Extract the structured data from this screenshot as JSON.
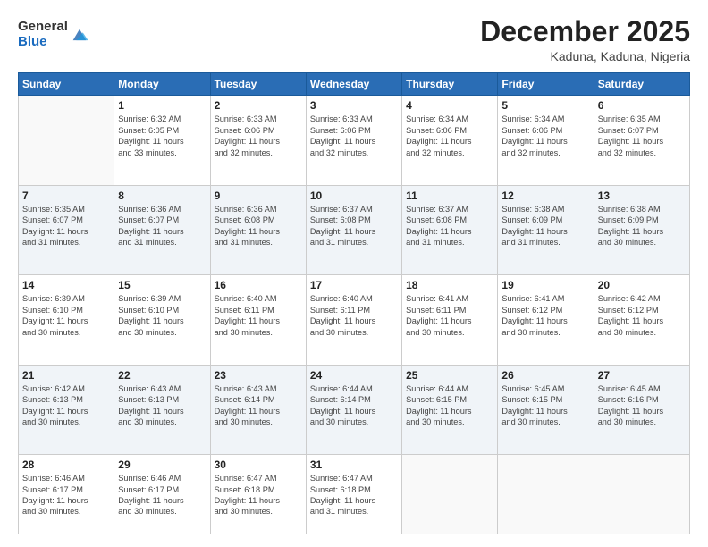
{
  "logo": {
    "general": "General",
    "blue": "Blue"
  },
  "header": {
    "month": "December 2025",
    "location": "Kaduna, Kaduna, Nigeria"
  },
  "days_of_week": [
    "Sunday",
    "Monday",
    "Tuesday",
    "Wednesday",
    "Thursday",
    "Friday",
    "Saturday"
  ],
  "weeks": [
    [
      {
        "day": "",
        "info": ""
      },
      {
        "day": "1",
        "info": "Sunrise: 6:32 AM\nSunset: 6:05 PM\nDaylight: 11 hours\nand 33 minutes."
      },
      {
        "day": "2",
        "info": "Sunrise: 6:33 AM\nSunset: 6:06 PM\nDaylight: 11 hours\nand 32 minutes."
      },
      {
        "day": "3",
        "info": "Sunrise: 6:33 AM\nSunset: 6:06 PM\nDaylight: 11 hours\nand 32 minutes."
      },
      {
        "day": "4",
        "info": "Sunrise: 6:34 AM\nSunset: 6:06 PM\nDaylight: 11 hours\nand 32 minutes."
      },
      {
        "day": "5",
        "info": "Sunrise: 6:34 AM\nSunset: 6:06 PM\nDaylight: 11 hours\nand 32 minutes."
      },
      {
        "day": "6",
        "info": "Sunrise: 6:35 AM\nSunset: 6:07 PM\nDaylight: 11 hours\nand 32 minutes."
      }
    ],
    [
      {
        "day": "7",
        "info": "Sunrise: 6:35 AM\nSunset: 6:07 PM\nDaylight: 11 hours\nand 31 minutes."
      },
      {
        "day": "8",
        "info": "Sunrise: 6:36 AM\nSunset: 6:07 PM\nDaylight: 11 hours\nand 31 minutes."
      },
      {
        "day": "9",
        "info": "Sunrise: 6:36 AM\nSunset: 6:08 PM\nDaylight: 11 hours\nand 31 minutes."
      },
      {
        "day": "10",
        "info": "Sunrise: 6:37 AM\nSunset: 6:08 PM\nDaylight: 11 hours\nand 31 minutes."
      },
      {
        "day": "11",
        "info": "Sunrise: 6:37 AM\nSunset: 6:08 PM\nDaylight: 11 hours\nand 31 minutes."
      },
      {
        "day": "12",
        "info": "Sunrise: 6:38 AM\nSunset: 6:09 PM\nDaylight: 11 hours\nand 31 minutes."
      },
      {
        "day": "13",
        "info": "Sunrise: 6:38 AM\nSunset: 6:09 PM\nDaylight: 11 hours\nand 30 minutes."
      }
    ],
    [
      {
        "day": "14",
        "info": "Sunrise: 6:39 AM\nSunset: 6:10 PM\nDaylight: 11 hours\nand 30 minutes."
      },
      {
        "day": "15",
        "info": "Sunrise: 6:39 AM\nSunset: 6:10 PM\nDaylight: 11 hours\nand 30 minutes."
      },
      {
        "day": "16",
        "info": "Sunrise: 6:40 AM\nSunset: 6:11 PM\nDaylight: 11 hours\nand 30 minutes."
      },
      {
        "day": "17",
        "info": "Sunrise: 6:40 AM\nSunset: 6:11 PM\nDaylight: 11 hours\nand 30 minutes."
      },
      {
        "day": "18",
        "info": "Sunrise: 6:41 AM\nSunset: 6:11 PM\nDaylight: 11 hours\nand 30 minutes."
      },
      {
        "day": "19",
        "info": "Sunrise: 6:41 AM\nSunset: 6:12 PM\nDaylight: 11 hours\nand 30 minutes."
      },
      {
        "day": "20",
        "info": "Sunrise: 6:42 AM\nSunset: 6:12 PM\nDaylight: 11 hours\nand 30 minutes."
      }
    ],
    [
      {
        "day": "21",
        "info": "Sunrise: 6:42 AM\nSunset: 6:13 PM\nDaylight: 11 hours\nand 30 minutes."
      },
      {
        "day": "22",
        "info": "Sunrise: 6:43 AM\nSunset: 6:13 PM\nDaylight: 11 hours\nand 30 minutes."
      },
      {
        "day": "23",
        "info": "Sunrise: 6:43 AM\nSunset: 6:14 PM\nDaylight: 11 hours\nand 30 minutes."
      },
      {
        "day": "24",
        "info": "Sunrise: 6:44 AM\nSunset: 6:14 PM\nDaylight: 11 hours\nand 30 minutes."
      },
      {
        "day": "25",
        "info": "Sunrise: 6:44 AM\nSunset: 6:15 PM\nDaylight: 11 hours\nand 30 minutes."
      },
      {
        "day": "26",
        "info": "Sunrise: 6:45 AM\nSunset: 6:15 PM\nDaylight: 11 hours\nand 30 minutes."
      },
      {
        "day": "27",
        "info": "Sunrise: 6:45 AM\nSunset: 6:16 PM\nDaylight: 11 hours\nand 30 minutes."
      }
    ],
    [
      {
        "day": "28",
        "info": "Sunrise: 6:46 AM\nSunset: 6:17 PM\nDaylight: 11 hours\nand 30 minutes."
      },
      {
        "day": "29",
        "info": "Sunrise: 6:46 AM\nSunset: 6:17 PM\nDaylight: 11 hours\nand 30 minutes."
      },
      {
        "day": "30",
        "info": "Sunrise: 6:47 AM\nSunset: 6:18 PM\nDaylight: 11 hours\nand 30 minutes."
      },
      {
        "day": "31",
        "info": "Sunrise: 6:47 AM\nSunset: 6:18 PM\nDaylight: 11 hours\nand 31 minutes."
      },
      {
        "day": "",
        "info": ""
      },
      {
        "day": "",
        "info": ""
      },
      {
        "day": "",
        "info": ""
      }
    ]
  ]
}
